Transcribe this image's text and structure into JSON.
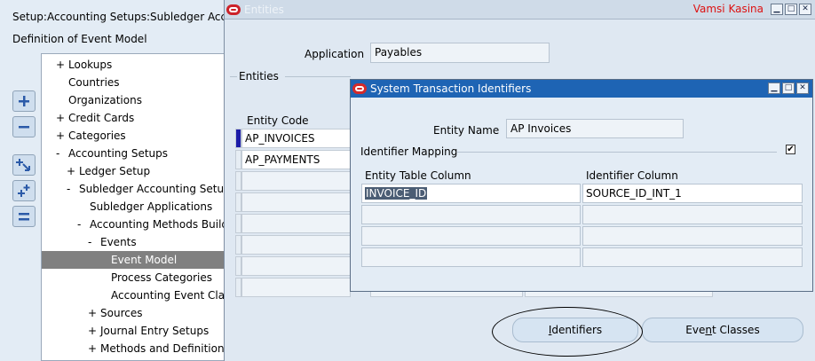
{
  "navigator": {
    "title": "Setup:Accounting Setups:Subledger Acco",
    "subtitle": "Definition of Event Model",
    "tree": [
      {
        "sign": "+",
        "label": "Lookups",
        "level": 0
      },
      {
        "sign": "",
        "label": "Countries",
        "level": 0
      },
      {
        "sign": "",
        "label": "Organizations",
        "level": 0
      },
      {
        "sign": "+",
        "label": "Credit Cards",
        "level": 0
      },
      {
        "sign": "+",
        "label": "Categories",
        "level": 0
      },
      {
        "sign": "-",
        "label": "Accounting Setups",
        "level": 0
      },
      {
        "sign": "+",
        "label": "Ledger Setup",
        "level": 1
      },
      {
        "sign": "-",
        "label": "Subledger Accounting Setup",
        "level": 1
      },
      {
        "sign": "",
        "label": "Subledger Applications",
        "level": 2
      },
      {
        "sign": "-",
        "label": "Accounting Methods Build",
        "level": 2
      },
      {
        "sign": "-",
        "label": "Events",
        "level": 3
      },
      {
        "sign": "",
        "label": "Event Model",
        "level": 4,
        "selected": true
      },
      {
        "sign": "",
        "label": "Process Categories",
        "level": 4
      },
      {
        "sign": "",
        "label": "Accounting Event Cla",
        "level": 4
      },
      {
        "sign": "+",
        "label": "Sources",
        "level": 3
      },
      {
        "sign": "+",
        "label": "Journal Entry Setups",
        "level": 3
      },
      {
        "sign": "+",
        "label": "Methods and Definitions",
        "level": 3
      }
    ],
    "buttons": [
      {
        "name": "expand-button",
        "icon": "plus-icon"
      },
      {
        "name": "collapse-button",
        "icon": "minus-icon"
      },
      {
        "name": "expand-branch-button",
        "icon": "expand-branch-icon"
      },
      {
        "name": "expand-all-button",
        "icon": "expand-all-icon"
      },
      {
        "name": "collapse-all-button",
        "icon": "collapse-all-icon"
      }
    ]
  },
  "entities_window": {
    "title": "Entities",
    "user": "Vamsi Kasina",
    "application_label": "Application",
    "application_value": "Payables",
    "entities_group_label": "Entities",
    "entity_code_header": "Entity Code",
    "entity_codes": [
      "AP_INVOICES",
      "AP_PAYMENTS",
      "",
      "",
      "",
      "",
      "",
      ""
    ],
    "identifiers_button": {
      "prefix": "",
      "mnemonic": "I",
      "suffix": "dentifiers"
    },
    "event_classes_button": {
      "prefix": "Eve",
      "mnemonic": "n",
      "suffix": "t Classes"
    }
  },
  "sti_window": {
    "title": "System Transaction Identifiers",
    "entity_name_label": "Entity Name",
    "entity_name_value": "AP Invoices",
    "identifier_mapping_label": "Identifier Mapping",
    "checkbox_checked": true,
    "checkbox_glyph": "✔",
    "entity_table_column_header": "Entity Table Column",
    "identifier_column_header": "Identifier Column",
    "rows": [
      {
        "entity_table_column": "INVOICE_ID",
        "identifier_column": "SOURCE_ID_INT_1"
      },
      {
        "entity_table_column": "",
        "identifier_column": ""
      },
      {
        "entity_table_column": "",
        "identifier_column": ""
      },
      {
        "entity_table_column": "",
        "identifier_column": ""
      }
    ]
  },
  "window_controls": {
    "minimize": "▁",
    "maximize": "□",
    "close": "✕"
  }
}
